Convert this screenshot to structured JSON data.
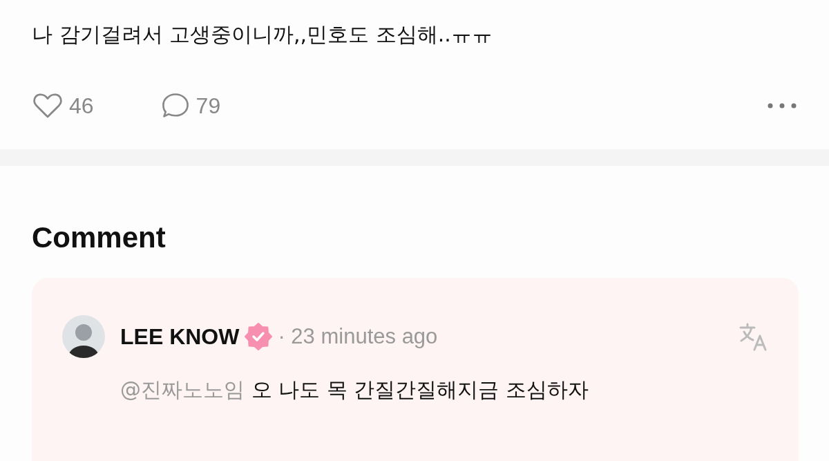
{
  "post": {
    "text": "나 감기걸려서 고생중이니까,,민호도 조심해..ㅠㅠ",
    "likes": "46",
    "comments": "79"
  },
  "comment_section": {
    "title": "Comment",
    "comments": [
      {
        "author": "LEE KNOW",
        "verified": true,
        "time": "· 23 minutes ago",
        "mention": "@진짜노노임",
        "text": "오 나도 목 간질간질해지금 조심하자"
      }
    ]
  }
}
